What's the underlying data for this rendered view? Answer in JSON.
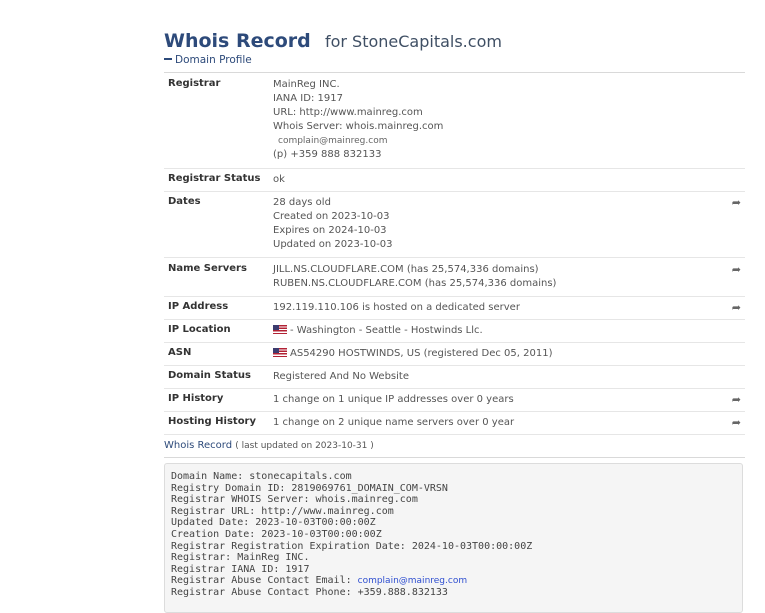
{
  "header": {
    "title_main": "Whois Record",
    "title_suffix": "for StoneCapitals.com"
  },
  "profile": {
    "section_label": "Domain Profile",
    "registrar": {
      "label": "Registrar",
      "name": "MainReg INC.",
      "iana": "IANA ID: 1917",
      "url": "URL: http://www.mainreg.com",
      "whois": "Whois Server: whois.mainreg.com",
      "email": "complain@mainreg.com",
      "phone_prefix": "(p)",
      "phone": "+359 888 832133"
    },
    "registrar_status": {
      "label": "Registrar Status",
      "value": "ok"
    },
    "dates": {
      "label": "Dates",
      "age": "28 days old",
      "created": "Created on 2023-10-03",
      "expires": "Expires on 2024-10-03",
      "updated": "Updated on 2023-10-03"
    },
    "name_servers": {
      "label": "Name Servers",
      "ns1": "JILL.NS.CLOUDFLARE.COM (has 25,574,336 domains)",
      "ns2": "RUBEN.NS.CLOUDFLARE.COM (has 25,574,336 domains)"
    },
    "ip_address": {
      "label": "IP Address",
      "value": "192.119.110.106 is hosted on a dedicated server"
    },
    "ip_location": {
      "label": "IP Location",
      "value": "- Washington - Seattle - Hostwinds Llc."
    },
    "asn": {
      "label": "ASN",
      "value": "AS54290 HOSTWINDS, US (registered Dec 05, 2011)"
    },
    "domain_status": {
      "label": "Domain Status",
      "value": "Registered And No Website"
    },
    "ip_history": {
      "label": "IP History",
      "value": "1 change on 1 unique IP addresses over 0 years"
    },
    "hosting_history": {
      "label": "Hosting History",
      "value": "1 change on 2 unique name servers over 0 year"
    }
  },
  "whois_record": {
    "title": "Whois Record",
    "updated": "( last updated on 2023-10-31 )",
    "lines": [
      "Domain Name: stonecapitals.com",
      "Registry Domain ID: 2819069761_DOMAIN_COM-VRSN",
      "Registrar WHOIS Server: whois.mainreg.com",
      "Registrar URL: http://www.mainreg.com",
      "Updated Date: 2023-10-03T00:00:00Z",
      "Creation Date: 2023-10-03T00:00:00Z",
      "Registrar Registration Expiration Date: 2024-10-03T00:00:00Z",
      "Registrar: MainReg INC.",
      "Registrar IANA ID: 1917"
    ],
    "abuse_email_label": "Registrar Abuse Contact Email:",
    "abuse_email": "complain@mainreg.com",
    "abuse_phone_line": "Registrar Abuse Contact Phone: +359.888.832133"
  },
  "icons": {
    "share": "share-arrow-icon",
    "flag": "us-flag-icon"
  },
  "colors": {
    "accent": "#2d4a7a",
    "link": "#2f4fd0"
  }
}
